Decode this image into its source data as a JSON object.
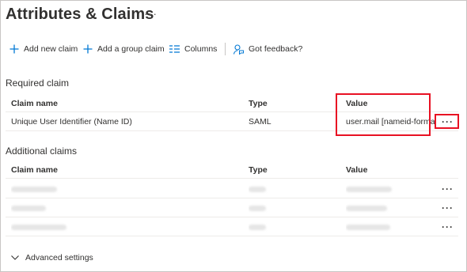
{
  "page": {
    "title": "Attributes & Claims",
    "title_more": "···"
  },
  "toolbar": {
    "add_new_claim": "Add new claim",
    "add_group_claim": "Add a group claim",
    "columns": "Columns",
    "feedback": "Got feedback?"
  },
  "required": {
    "section_title": "Required claim",
    "headers": {
      "name": "Claim name",
      "type": "Type",
      "value": "Value"
    },
    "rows": [
      {
        "name": "Unique User Identifier (Name ID)",
        "type": "SAML",
        "value": "user.mail [nameid-forma...",
        "more": "···"
      }
    ]
  },
  "additional": {
    "section_title": "Additional claims",
    "headers": {
      "name": "Claim name",
      "type": "Type",
      "value": "Value"
    },
    "rows": [
      {
        "more": "···"
      },
      {
        "more": "···"
      },
      {
        "more": "···"
      }
    ]
  },
  "advanced": {
    "label": "Advanced settings"
  },
  "colors": {
    "accent": "#0078d4",
    "highlight": "#e81123",
    "text": "#323130",
    "border": "#edebe9"
  }
}
